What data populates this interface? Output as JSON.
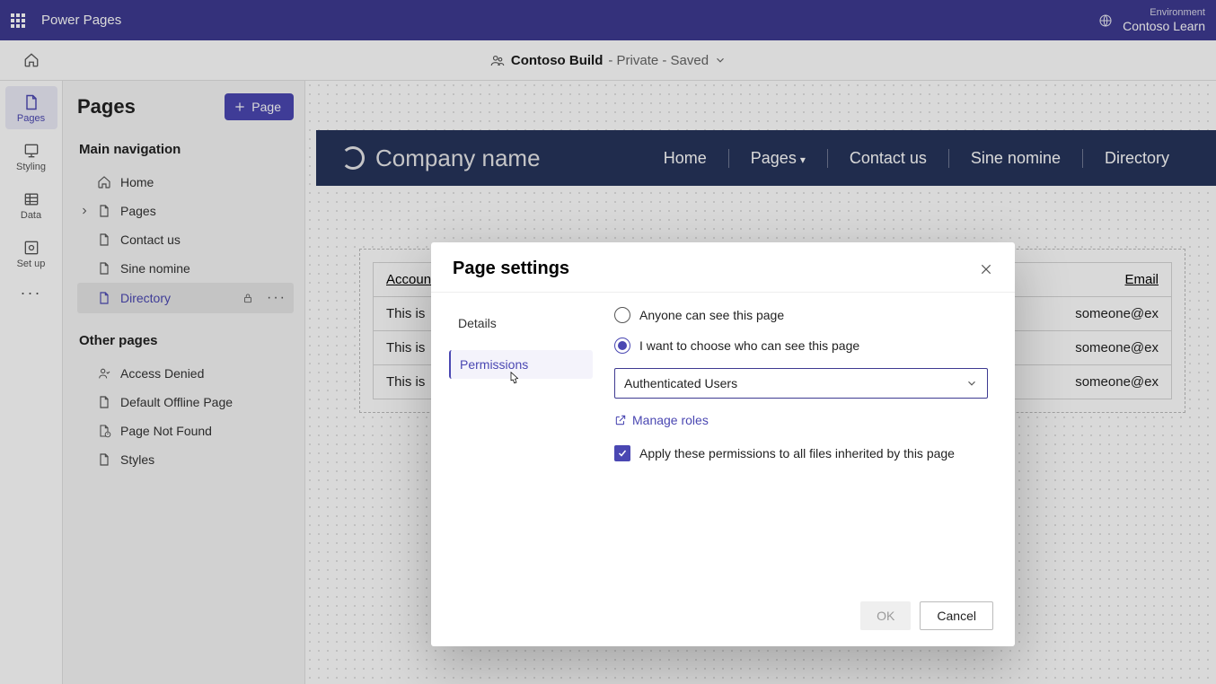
{
  "topbar": {
    "title": "Power Pages",
    "env_label": "Environment",
    "env_name": "Contoso Learn"
  },
  "breadcrumb": {
    "site": "Contoso Build",
    "state": " - Private - Saved"
  },
  "rail": [
    {
      "id": "pages",
      "label": "Pages"
    },
    {
      "id": "styling",
      "label": "Styling"
    },
    {
      "id": "data",
      "label": "Data"
    },
    {
      "id": "setup",
      "label": "Set up"
    }
  ],
  "panel": {
    "title": "Pages",
    "add_label": "Page",
    "section_main": "Main navigation",
    "section_other": "Other pages",
    "main_nav": [
      {
        "id": "home",
        "label": "Home",
        "icon": "home"
      },
      {
        "id": "pages",
        "label": "Pages",
        "icon": "file",
        "expandable": true
      },
      {
        "id": "contact",
        "label": "Contact us",
        "icon": "file"
      },
      {
        "id": "sine",
        "label": "Sine nomine",
        "icon": "file"
      },
      {
        "id": "directory",
        "label": "Directory",
        "icon": "file",
        "selected": true,
        "locked": true
      }
    ],
    "other_nav": [
      {
        "id": "access",
        "label": "Access Denied",
        "icon": "person"
      },
      {
        "id": "offline",
        "label": "Default Offline Page",
        "icon": "file"
      },
      {
        "id": "404",
        "label": "Page Not Found",
        "icon": "file-err"
      },
      {
        "id": "styles",
        "label": "Styles",
        "icon": "file"
      }
    ]
  },
  "site_header": {
    "brand": "Company name",
    "nav": [
      "Home",
      "Pages",
      "Contact us",
      "Sine nomine",
      "Directory"
    ]
  },
  "table": {
    "headers": [
      "Account",
      "Email"
    ],
    "rows": [
      {
        "account": "This is",
        "email": "someone@ex"
      },
      {
        "account": "This is",
        "email": "someone@ex"
      },
      {
        "account": "This is",
        "email": "someone@ex"
      }
    ]
  },
  "modal": {
    "title": "Page settings",
    "tabs": {
      "details": "Details",
      "permissions": "Permissions"
    },
    "radio_anyone": "Anyone can see this page",
    "radio_choose": "I want to choose who can see this page",
    "select_value": "Authenticated Users",
    "manage_roles": "Manage roles",
    "inherit_label": "Apply these permissions to all files inherited by this page",
    "ok": "OK",
    "cancel": "Cancel"
  }
}
